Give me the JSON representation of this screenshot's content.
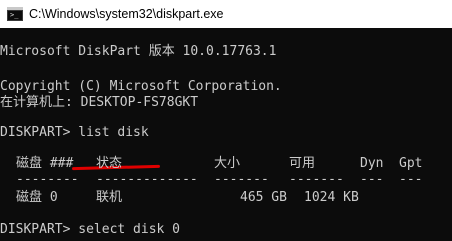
{
  "window": {
    "title": "C:\\Windows\\system32\\diskpart.exe"
  },
  "console": {
    "version_line": "Microsoft DiskPart 版本 10.0.17763.1",
    "copyright_line": "Copyright (C) Microsoft Corporation.",
    "computer_line": "在计算机上: DESKTOP-FS78GKT",
    "prompt1": "DISKPART> list disk",
    "prompt2": "DISKPART> select disk 0"
  },
  "disk_table": {
    "headers": [
      "磁盘 ###",
      "状态",
      "大小",
      "可用",
      "Dyn",
      "Gpt"
    ],
    "separators": [
      "--------",
      "-------------",
      "-------",
      "-------",
      "---",
      "---"
    ],
    "rows": [
      {
        "disk": "磁盘 0",
        "status": "联机",
        "size": "465 GB",
        "free": "1024 KB",
        "dyn": "",
        "gpt": ""
      }
    ]
  },
  "annotation": {
    "color": "#e00000"
  }
}
